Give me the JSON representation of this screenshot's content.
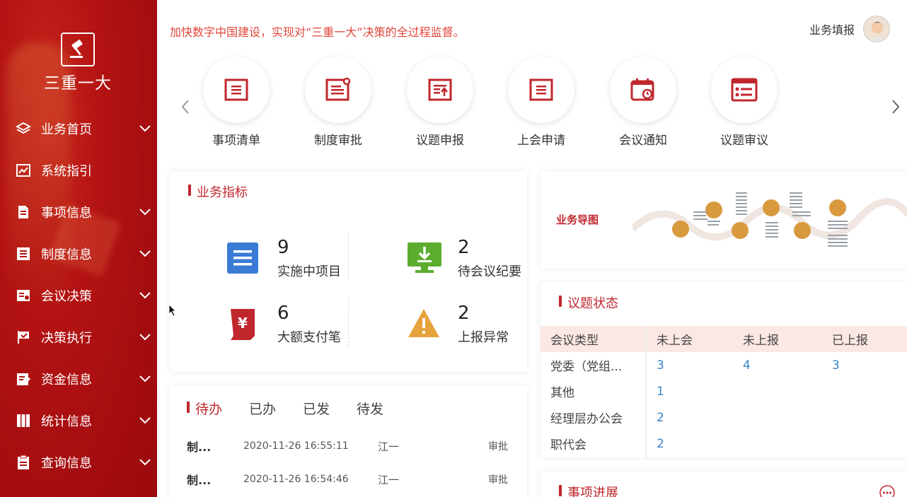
{
  "app": {
    "logo_text": "三重一大"
  },
  "sidebar": {
    "items": [
      {
        "label": "业务首页",
        "icon": "layers-icon",
        "has_chevron": true
      },
      {
        "label": "系统指引",
        "icon": "chart-icon",
        "has_chevron": false
      },
      {
        "label": "事项信息",
        "icon": "document-icon",
        "has_chevron": true
      },
      {
        "label": "制度信息",
        "icon": "list-icon",
        "has_chevron": true
      },
      {
        "label": "会议决策",
        "icon": "meeting-icon",
        "has_chevron": true
      },
      {
        "label": "决策执行",
        "icon": "flag-icon",
        "has_chevron": true
      },
      {
        "label": "资金信息",
        "icon": "edit-icon",
        "has_chevron": true
      },
      {
        "label": "统计信息",
        "icon": "books-icon",
        "has_chevron": true
      },
      {
        "label": "查询信息",
        "icon": "clipboard-icon",
        "has_chevron": true
      }
    ]
  },
  "header": {
    "slogan": "加快数字中国建设，实现对“三重一大”决策的全过程监督。",
    "user_role": "业务填报"
  },
  "quick_links": [
    {
      "label": "事项清单",
      "icon": "list-doc-icon"
    },
    {
      "label": "制度审批",
      "icon": "approval-doc-icon"
    },
    {
      "label": "议题申报",
      "icon": "upload-doc-icon"
    },
    {
      "label": "上会申请",
      "icon": "doc-lines-icon"
    },
    {
      "label": "会议通知",
      "icon": "calendar-clock-icon"
    },
    {
      "label": "议题审议",
      "icon": "review-list-icon"
    }
  ],
  "indicators": {
    "title": "业务指标",
    "items": [
      {
        "value": "9",
        "label": "实施中项目",
        "icon": "list-icon",
        "color": "#3a7bd5"
      },
      {
        "value": "2",
        "label": "待会议纪要",
        "icon": "monitor-download-icon",
        "color": "#5cad2e"
      },
      {
        "value": "6",
        "label": "大额支付笔",
        "icon": "yen-icon",
        "color": "#c0272d"
      },
      {
        "value": "2",
        "label": "上报异常",
        "icon": "warning-icon",
        "color": "#e6a33c"
      }
    ]
  },
  "todo": {
    "tabs": [
      "待办",
      "已办",
      "已发",
      "待发"
    ],
    "rows": [
      {
        "name": "制...",
        "time": "2020-11-26 16:55:11",
        "user": "江一",
        "action": "审批"
      },
      {
        "name": "制...",
        "time": "2020-11-26 16:54:46",
        "user": "江一",
        "action": "审批"
      }
    ]
  },
  "business_map": {
    "title": "业务导图"
  },
  "topic_status": {
    "title": "议题状态",
    "headers": [
      "会议类型",
      "未上会",
      "未上报",
      "已上报"
    ],
    "rows": [
      [
        "党委（党组...",
        "3",
        "4",
        "3"
      ],
      [
        "其他",
        "1",
        "",
        ""
      ],
      [
        "经理层办公会",
        "2",
        "",
        ""
      ],
      [
        "职代会",
        "2",
        "",
        ""
      ]
    ]
  },
  "progress": {
    "title": "事项进展",
    "more_icon": "more-icon"
  },
  "colors": {
    "brand_red": "#c0272d",
    "sidebar_red": "#b41313",
    "link_blue": "#3a86c8",
    "slogan_red": "#e0463a"
  }
}
